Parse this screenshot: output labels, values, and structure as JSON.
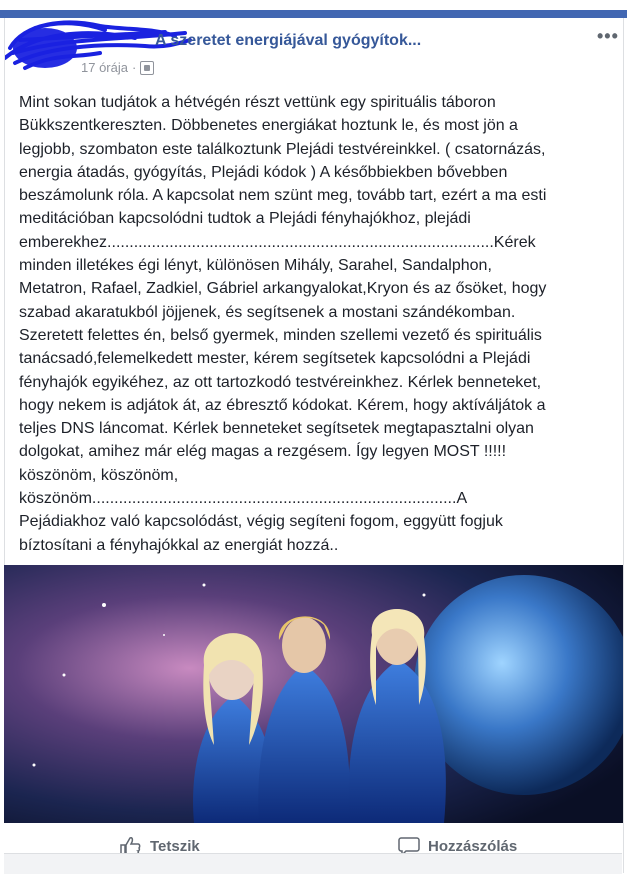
{
  "post": {
    "title": "A szeretet energiájával gyógyítok...",
    "time": "17 órája",
    "audience_icon": "public-icon",
    "more_icon": "more-options-icon",
    "lines": [
      "Mint sokan tudjátok a hétvégén részt vettünk egy spirituális táboron",
      "Bükkszentkereszten. Döbbenetes energiákat hoztunk le, és most jön a",
      "legjobb, szombaton este találkoztunk Plejádi testvéreinkkel. ( csatornázás,",
      "energia átadás, gyógyítás, Plejádi kódok ) A későbbiekben bővebben",
      "beszámolunk róla. A kapcsolat nem szünt meg, tovább tart, ezért a ma esti",
      "meditációban kapcsolódni tudtok a Plejádi fényhajókhoz, plejádi",
      "emberekhez.......................................................................................Kérek",
      "minden illetékes égi lényt, különösen Mihály, Sarahel, Sandalphon,",
      "Metatron, Rafael, Zadkiel, Gábriel arkangyalokat,Kryon és az ősöket, hogy",
      "szabad akaratukból jöjjenek, és segítsenek a mostani szándékomban.",
      "Szeretett felettes én, belső gyermek, minden szellemi vezető és spirituális",
      "tanácsadó,felemelkedett mester, kérem segítsetek kapcsolódni a Plejádi",
      "fényhajók egyikéhez, az ott tartozkodó testvéreinkhez. Kérlek benneteket,",
      "hogy nekem is adjátok át, az ébresztő kódokat. Kérem, hogy aktíváljátok a",
      "teljes DNS láncomat. Kérlek benneteket segítsetek megtapasztalni olyan",
      "dolgokat, amihez már elég magas a rezgésem. Így legyen MOST !!!!!",
      "köszönöm, köszönöm,",
      "köszönöm..................................................................................A",
      "Pejádiakhoz való kapcsolódást, végig segíteni fogom, eggyütt fogjuk",
      "bíztosítani a fényhajókkal az energiát hozzá.."
    ]
  },
  "actions": {
    "like_label": "Tetszik",
    "like_icon": "thumbs-up-icon",
    "comment_label": "Hozzászólás",
    "comment_icon": "comment-icon"
  },
  "colors": {
    "brand": "#4267b2",
    "link": "#365899",
    "scribble": "#1a22e0"
  }
}
